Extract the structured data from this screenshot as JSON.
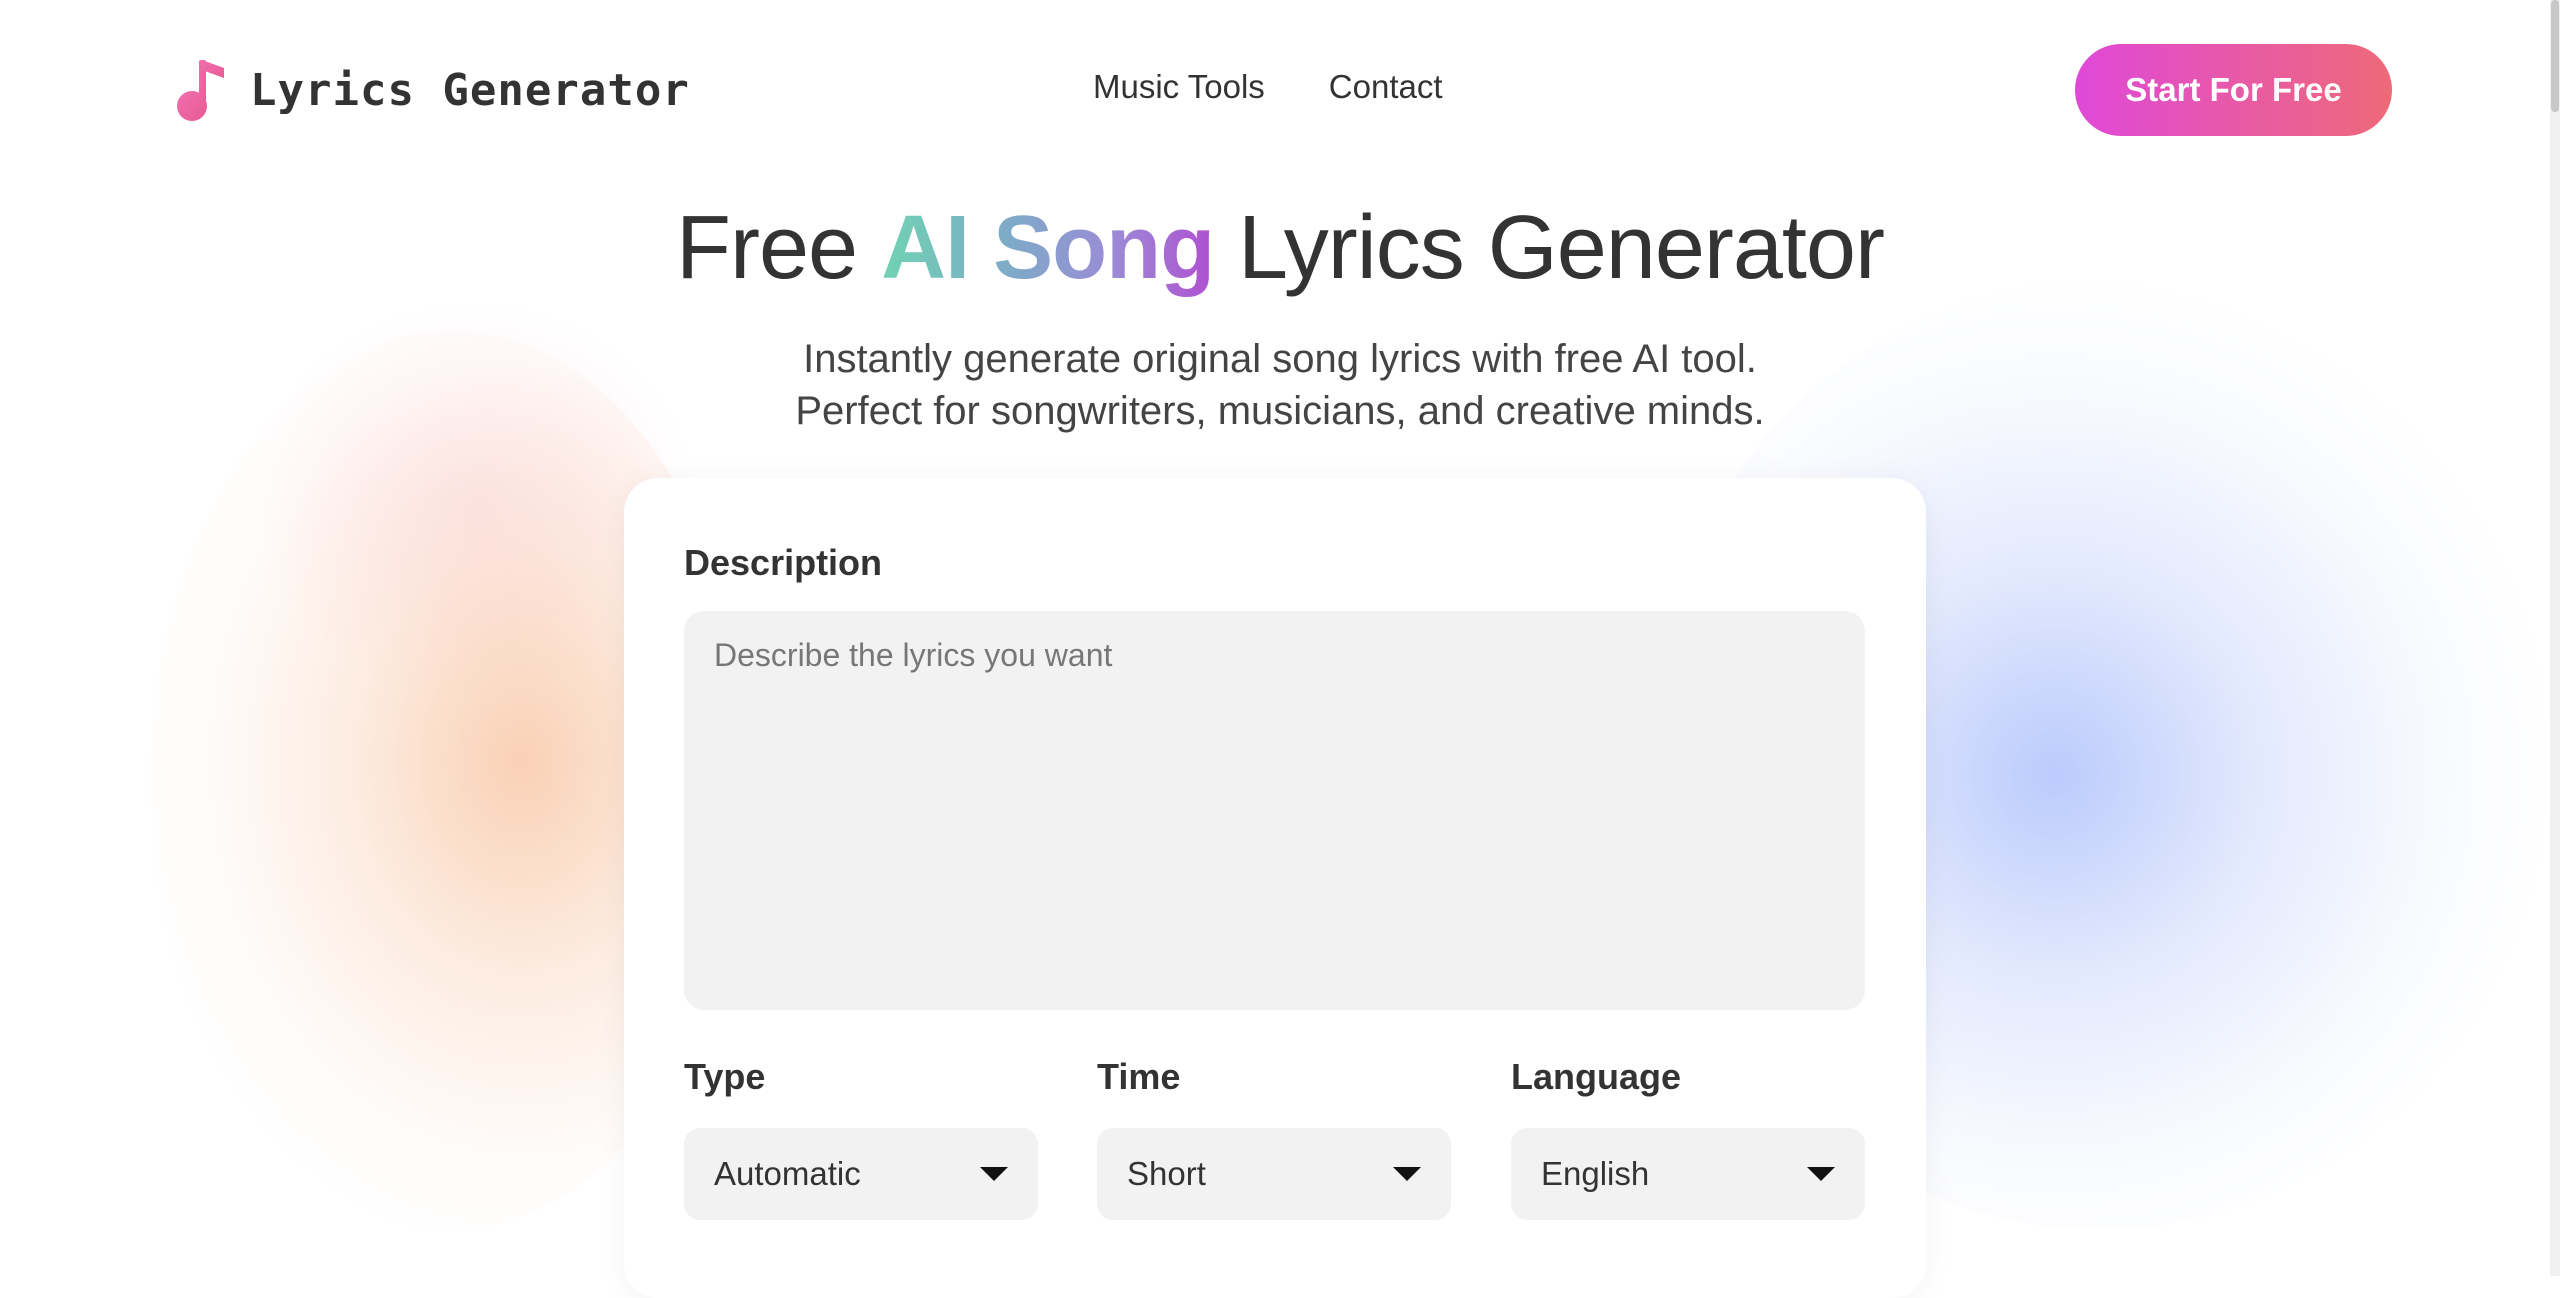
{
  "header": {
    "logo_text": "Lyrics Generator",
    "logo_icon": "music-note-icon",
    "nav": [
      {
        "label": "Music Tools"
      },
      {
        "label": "Contact"
      }
    ],
    "cta_label": "Start For Free"
  },
  "hero": {
    "title_prefix": "Free ",
    "title_highlight": "AI Song",
    "title_suffix": " Lyrics Generator",
    "subtitle_line1": "Instantly generate original song lyrics with free AI tool.",
    "subtitle_line2": "Perfect for songwriters, musicians, and creative minds."
  },
  "form": {
    "description_label": "Description",
    "description_placeholder": "Describe the lyrics you want",
    "description_value": "",
    "type": {
      "label": "Type",
      "value": "Automatic"
    },
    "time": {
      "label": "Time",
      "value": "Short"
    },
    "language": {
      "label": "Language",
      "value": "English"
    }
  },
  "colors": {
    "cta_gradient_start": "#e048d8",
    "cta_gradient_end": "#ee6a78",
    "highlight_gradient_start": "#6fd3b2",
    "highlight_gradient_end": "#b04fd0",
    "logo_icon": "#ee5fa0",
    "input_background": "#f2f2f2",
    "text": "#333333"
  }
}
